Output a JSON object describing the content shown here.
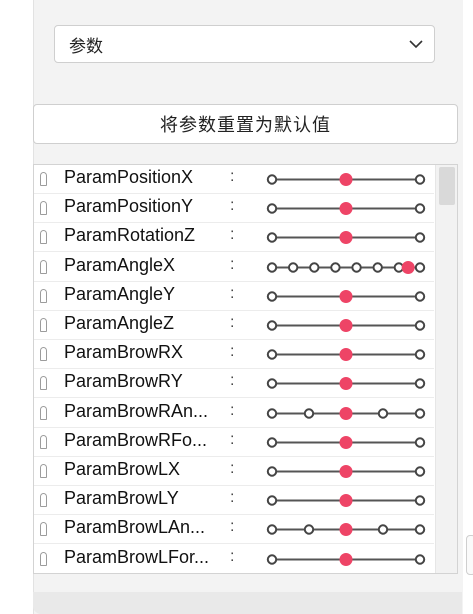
{
  "dropdown": {
    "value": "参数"
  },
  "reset_button": {
    "label": "将参数重置为默认值"
  },
  "colors": {
    "accent": "#ee4466",
    "line": "#555555",
    "knob_open": "#444444"
  },
  "params": [
    {
      "name": "ParamPositionX",
      "keys": 2,
      "value": 0.5
    },
    {
      "name": "ParamPositionY",
      "keys": 2,
      "value": 0.5
    },
    {
      "name": "ParamRotationZ",
      "keys": 2,
      "value": 0.5
    },
    {
      "name": "ParamAngleX",
      "keys": 8,
      "value": 0.92
    },
    {
      "name": "ParamAngleY",
      "keys": 2,
      "value": 0.5
    },
    {
      "name": "ParamAngleZ",
      "keys": 2,
      "value": 0.5
    },
    {
      "name": "ParamBrowRX",
      "keys": 2,
      "value": 0.5
    },
    {
      "name": "ParamBrowRY",
      "keys": 2,
      "value": 0.5
    },
    {
      "name": "ParamBrowRAn...",
      "keys": 5,
      "value": 0.5
    },
    {
      "name": "ParamBrowRFo...",
      "keys": 3,
      "value": 0.5
    },
    {
      "name": "ParamBrowLX",
      "keys": 2,
      "value": 0.5
    },
    {
      "name": "ParamBrowLY",
      "keys": 2,
      "value": 0.5
    },
    {
      "name": "ParamBrowLAn...",
      "keys": 5,
      "value": 0.5
    },
    {
      "name": "ParamBrowLFor...",
      "keys": 3,
      "value": 0.5
    }
  ]
}
